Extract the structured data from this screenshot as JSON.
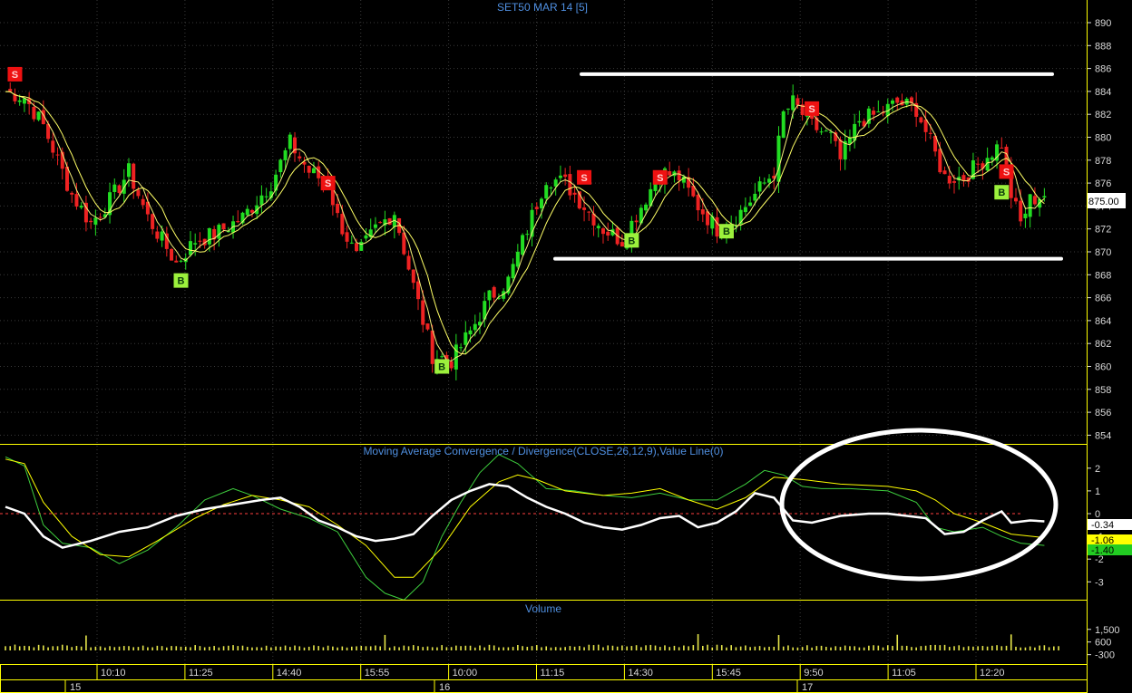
{
  "chart_data": [
    {
      "type": "candlestick",
      "title": "SET50 MAR 14   [5]",
      "ylim": [
        853,
        891
      ],
      "y_ticks": [
        854,
        856,
        858,
        860,
        862,
        864,
        866,
        868,
        870,
        872,
        874,
        876,
        878,
        880,
        882,
        884,
        886,
        888,
        890
      ],
      "last_price_label": "875.00",
      "x_tick_labels": [
        "10:10",
        "11:25",
        "14:40",
        "15:55",
        "10:00",
        "11:15",
        "14:30",
        "15:45",
        "9:50",
        "11:05",
        "12:20"
      ],
      "day_labels": [
        "15",
        "16",
        "17"
      ],
      "close_path": [
        [
          0,
          884
        ],
        [
          4,
          883.5
        ],
        [
          8,
          881
        ],
        [
          14,
          875
        ],
        [
          18,
          872.5
        ],
        [
          22,
          874.5
        ],
        [
          26,
          877
        ],
        [
          30,
          873
        ],
        [
          36,
          869
        ],
        [
          40,
          871
        ],
        [
          44,
          871.5
        ],
        [
          50,
          873
        ],
        [
          56,
          876
        ],
        [
          60,
          879.5
        ],
        [
          64,
          877
        ],
        [
          68,
          876
        ],
        [
          70,
          873
        ],
        [
          74,
          869.5
        ],
        [
          78,
          872
        ],
        [
          82,
          873.5
        ],
        [
          86,
          867
        ],
        [
          90,
          861
        ],
        [
          94,
          860.5
        ],
        [
          98,
          863
        ],
        [
          102,
          866
        ],
        [
          106,
          867.5
        ],
        [
          110,
          872
        ],
        [
          114,
          876.5
        ],
        [
          118,
          876
        ],
        [
          122,
          874
        ],
        [
          126,
          872
        ],
        [
          130,
          871
        ],
        [
          134,
          874
        ],
        [
          138,
          877
        ],
        [
          142,
          876.5
        ],
        [
          146,
          874
        ],
        [
          150,
          872
        ],
        [
          154,
          873
        ],
        [
          158,
          875
        ],
        [
          162,
          877
        ],
        [
          164,
          882
        ],
        [
          166,
          883
        ],
        [
          170,
          881
        ],
        [
          174,
          880
        ],
        [
          176,
          878
        ],
        [
          180,
          881.5
        ],
        [
          184,
          882
        ],
        [
          188,
          883
        ],
        [
          192,
          882.5
        ],
        [
          194,
          880.5
        ],
        [
          198,
          876.5
        ],
        [
          202,
          876.5
        ],
        [
          206,
          878
        ],
        [
          210,
          879.5
        ],
        [
          212,
          875
        ],
        [
          214,
          872.5
        ],
        [
          216,
          874.5
        ],
        [
          219,
          875
        ]
      ],
      "buy_signals": [
        [
          37,
          867.5
        ],
        [
          92,
          860
        ],
        [
          132,
          871
        ],
        [
          152,
          871.8
        ],
        [
          210,
          875.2
        ]
      ],
      "sell_signals": [
        [
          2,
          885.5
        ],
        [
          68,
          876
        ],
        [
          122,
          876.5
        ],
        [
          138,
          876.5
        ],
        [
          170,
          882.5
        ],
        [
          211,
          877
        ]
      ],
      "resistance_line": 885.5,
      "support_line": 869.4
    },
    {
      "type": "line",
      "title": "Moving Average Convergence / Divergence(CLOSE,26,12,9),Value Line(0)",
      "ylim": [
        -3.9,
        3.3
      ],
      "y_ticks": [
        -3,
        -2,
        -1,
        0,
        1,
        2
      ],
      "zero_line": 0,
      "series": [
        {
          "values_label": "-0.34",
          "color": "#ffffff",
          "points": [
            [
              0,
              0.3
            ],
            [
              4,
              0
            ],
            [
              8,
              -1
            ],
            [
              12,
              -1.5
            ],
            [
              18,
              -1.2
            ],
            [
              24,
              -0.8
            ],
            [
              30,
              -0.6
            ],
            [
              36,
              -0.1
            ],
            [
              42,
              0.2
            ],
            [
              48,
              0.4
            ],
            [
              54,
              0.6
            ],
            [
              58,
              0.7
            ],
            [
              62,
              0.3
            ],
            [
              66,
              -0.3
            ],
            [
              70,
              -0.6
            ],
            [
              74,
              -1
            ],
            [
              78,
              -1.2
            ],
            [
              82,
              -1.1
            ],
            [
              86,
              -0.9
            ],
            [
              90,
              -0.1
            ],
            [
              94,
              0.6
            ],
            [
              98,
              1
            ],
            [
              102,
              1.3
            ],
            [
              106,
              1.2
            ],
            [
              110,
              0.7
            ],
            [
              114,
              0.3
            ],
            [
              118,
              0
            ],
            [
              122,
              -0.4
            ],
            [
              126,
              -0.6
            ],
            [
              130,
              -0.7
            ],
            [
              134,
              -0.5
            ],
            [
              138,
              -0.2
            ],
            [
              142,
              -0.1
            ],
            [
              146,
              -0.6
            ],
            [
              150,
              -0.4
            ],
            [
              154,
              0.1
            ],
            [
              158,
              0.9
            ],
            [
              162,
              0.7
            ],
            [
              166,
              -0.3
            ],
            [
              170,
              -0.4
            ],
            [
              176,
              -0.1
            ],
            [
              182,
              0
            ],
            [
              186,
              0
            ],
            [
              190,
              -0.1
            ],
            [
              194,
              -0.2
            ],
            [
              198,
              -0.9
            ],
            [
              202,
              -0.8
            ],
            [
              206,
              -0.3
            ],
            [
              210,
              0.1
            ],
            [
              212,
              -0.4
            ],
            [
              216,
              -0.3
            ],
            [
              219,
              -0.34
            ]
          ]
        },
        {
          "values_label": "-1.06",
          "color": "#ffff00",
          "points": [
            [
              0,
              2.4
            ],
            [
              4,
              2.2
            ],
            [
              8,
              0.5
            ],
            [
              14,
              -1
            ],
            [
              20,
              -1.8
            ],
            [
              26,
              -1.9
            ],
            [
              32,
              -1.2
            ],
            [
              40,
              -0.2
            ],
            [
              46,
              0.4
            ],
            [
              52,
              0.8
            ],
            [
              58,
              0.6
            ],
            [
              64,
              0.3
            ],
            [
              70,
              -0.5
            ],
            [
              76,
              -1.4
            ],
            [
              82,
              -2.8
            ],
            [
              86,
              -2.8
            ],
            [
              92,
              -1.5
            ],
            [
              98,
              0.3
            ],
            [
              104,
              1.4
            ],
            [
              108,
              1.7
            ],
            [
              112,
              1.5
            ],
            [
              118,
              1
            ],
            [
              126,
              0.8
            ],
            [
              132,
              0.9
            ],
            [
              138,
              1.1
            ],
            [
              144,
              0.6
            ],
            [
              150,
              0.2
            ],
            [
              156,
              0.7
            ],
            [
              162,
              1.6
            ],
            [
              168,
              1.5
            ],
            [
              176,
              1.3
            ],
            [
              186,
              1.2
            ],
            [
              192,
              1
            ],
            [
              196,
              0.6
            ],
            [
              200,
              0
            ],
            [
              206,
              -0.4
            ],
            [
              212,
              -0.9
            ],
            [
              219,
              -1.06
            ]
          ]
        },
        {
          "values_label": "-1.40",
          "color": "#3ecf3e",
          "points": [
            [
              0,
              2.5
            ],
            [
              4,
              2.1
            ],
            [
              8,
              -0.5
            ],
            [
              12,
              -1.3
            ],
            [
              18,
              -1.5
            ],
            [
              24,
              -2.2
            ],
            [
              30,
              -1.6
            ],
            [
              36,
              -0.6
            ],
            [
              42,
              0.6
            ],
            [
              48,
              1.1
            ],
            [
              52,
              0.8
            ],
            [
              58,
              0.2
            ],
            [
              64,
              -0.2
            ],
            [
              70,
              -0.8
            ],
            [
              76,
              -2.8
            ],
            [
              80,
              -3.5
            ],
            [
              84,
              -3.8
            ],
            [
              88,
              -3
            ],
            [
              92,
              -1
            ],
            [
              96,
              0.5
            ],
            [
              100,
              1.8
            ],
            [
              104,
              2.6
            ],
            [
              108,
              2.2
            ],
            [
              114,
              1.1
            ],
            [
              120,
              1
            ],
            [
              126,
              0.8
            ],
            [
              132,
              0.7
            ],
            [
              138,
              0.9
            ],
            [
              144,
              0.6
            ],
            [
              150,
              0.6
            ],
            [
              156,
              1.3
            ],
            [
              160,
              1.9
            ],
            [
              164,
              1.7
            ],
            [
              168,
              1.2
            ],
            [
              172,
              1.1
            ],
            [
              178,
              1.1
            ],
            [
              186,
              1
            ],
            [
              192,
              0.5
            ],
            [
              196,
              -0.6
            ],
            [
              200,
              -0.8
            ],
            [
              206,
              -0.6
            ],
            [
              210,
              -1
            ],
            [
              214,
              -1.3
            ],
            [
              219,
              -1.4
            ]
          ]
        }
      ],
      "highlight": "ellipse"
    },
    {
      "type": "bar",
      "title": "Volume",
      "ylim": [
        -650,
        1750
      ],
      "y_ticks": [
        -300,
        600,
        1500
      ],
      "y_tick_labels": [
        "-300",
        "600",
        "1,500"
      ],
      "bar_count": 220,
      "values": [
        302,
        306,
        416,
        297,
        328,
        308,
        223,
        397,
        354,
        223,
        301,
        302,
        406,
        355,
        244,
        322,
        278,
        1063,
        222,
        269,
        291,
        205,
        301,
        238,
        273,
        318,
        307,
        233,
        250,
        346,
        227,
        225,
        331,
        311,
        211,
        316,
        304,
        265,
        270,
        230,
        383,
        312,
        224,
        265,
        319,
        211,
        305,
        335,
        380,
        316,
        341,
        254,
        216,
        234,
        212,
        336,
        219,
        286,
        265,
        350,
        249,
        351,
        292,
        207,
        263,
        363,
        317,
        228,
        340,
        279,
        213,
        284,
        208,
        270,
        293,
        322,
        300,
        294,
        352,
        290,
        1103,
        206,
        299,
        229,
        348,
        296,
        382,
        312,
        247,
        282,
        232,
        223,
        382,
        234,
        242,
        347,
        309,
        336,
        337,
        204,
        355,
        219,
        398,
        356,
        220,
        225,
        225,
        253,
        388,
        309,
        259,
        310,
        384,
        229,
        292,
        209,
        244,
        214,
        246,
        313,
        266,
        313,
        231,
        406,
        383,
        410,
        227,
        359,
        337,
        271,
        353,
        285,
        316,
        374,
        234,
        366,
        392,
        350,
        254,
        363,
        246,
        327,
        232,
        352,
        297,
        384,
        1160,
        323,
        407,
        213,
        407,
        381,
        214,
        378,
        230,
        280,
        356,
        242,
        274,
        312,
        226,
        263,
        262,
        1098,
        279,
        358,
        219,
        210,
        248,
        371,
        204,
        314,
        329,
        259,
        212,
        302,
        251,
        349,
        301,
        300,
        218,
        214,
        337,
        371,
        344,
        215,
        370,
        326,
        1115,
        333,
        327,
        246,
        218,
        311,
        336,
        387,
        393,
        377,
        395,
        255,
        302,
        366,
        239,
        300,
        272,
        297,
        321,
        276,
        332,
        375,
        301,
        330,
        1140,
        263,
        213,
        213,
        288,
        211,
        350,
        370,
        232,
        289,
        305
      ]
    }
  ]
}
